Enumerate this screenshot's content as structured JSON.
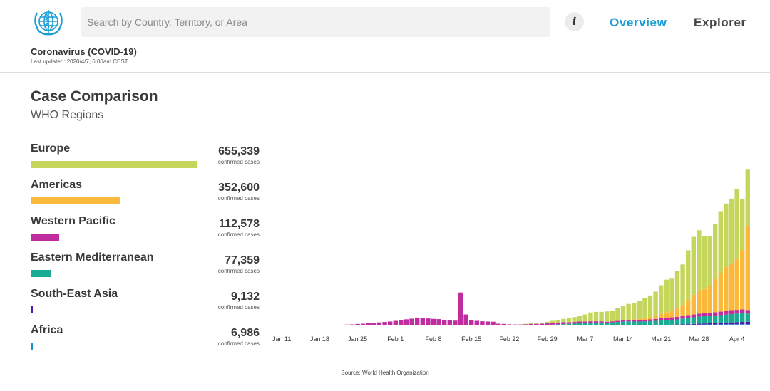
{
  "header": {
    "search_placeholder": "Search by Country, Territory, or Area",
    "info_label": "i",
    "nav": [
      "Overview",
      "Explorer"
    ],
    "app_title": "Coronavirus (COVID-19)",
    "last_updated": "Last updated: 2020/4/7, 6:00am CEST"
  },
  "section": {
    "title": "Case Comparison",
    "subtitle": "WHO Regions"
  },
  "regions": [
    {
      "name": "Europe",
      "value": "655,339",
      "label": "confirmed cases",
      "cases": 655339,
      "color": "#c4d65c"
    },
    {
      "name": "Americas",
      "value": "352,600",
      "label": "confirmed cases",
      "cases": 352600,
      "color": "#fbb93b"
    },
    {
      "name": "Western Pacific",
      "value": "112,578",
      "label": "confirmed cases",
      "cases": 112578,
      "color": "#bf2d9e"
    },
    {
      "name": "Eastern Mediterranean",
      "value": "77,359",
      "label": "confirmed cases",
      "cases": 77359,
      "color": "#19ab93"
    },
    {
      "name": "South-East Asia",
      "value": "9,132",
      "label": "confirmed cases",
      "cases": 9132,
      "color": "#4c1aa8"
    },
    {
      "name": "Africa",
      "value": "6,986",
      "label": "confirmed cases",
      "cases": 6986,
      "color": "#1c8fd1"
    }
  ],
  "chart_data": {
    "type": "bar",
    "stacked": true,
    "x_ticks": [
      "Jan 11",
      "Jan 18",
      "Jan 25",
      "Feb 1",
      "Feb 8",
      "Feb 15",
      "Feb 22",
      "Feb 29",
      "Mar 7",
      "Mar 14",
      "Mar 21",
      "Mar 28",
      "Apr 4"
    ],
    "x": [
      "Jan 11",
      "Jan 12",
      "Jan 13",
      "Jan 14",
      "Jan 15",
      "Jan 16",
      "Jan 17",
      "Jan 18",
      "Jan 19",
      "Jan 20",
      "Jan 21",
      "Jan 22",
      "Jan 23",
      "Jan 24",
      "Jan 25",
      "Jan 26",
      "Jan 27",
      "Jan 28",
      "Jan 29",
      "Jan 30",
      "Jan 31",
      "Feb 1",
      "Feb 2",
      "Feb 3",
      "Feb 4",
      "Feb 5",
      "Feb 6",
      "Feb 7",
      "Feb 8",
      "Feb 9",
      "Feb 10",
      "Feb 11",
      "Feb 12",
      "Feb 13",
      "Feb 14",
      "Feb 15",
      "Feb 16",
      "Feb 17",
      "Feb 18",
      "Feb 19",
      "Feb 20",
      "Feb 21",
      "Feb 22",
      "Feb 23",
      "Feb 24",
      "Feb 25",
      "Feb 26",
      "Feb 27",
      "Feb 28",
      "Feb 29",
      "Mar 1",
      "Mar 2",
      "Mar 3",
      "Mar 4",
      "Mar 5",
      "Mar 6",
      "Mar 7",
      "Mar 8",
      "Mar 9",
      "Mar 10",
      "Mar 11",
      "Mar 12",
      "Mar 13",
      "Mar 14",
      "Mar 15",
      "Mar 16",
      "Mar 17",
      "Mar 18",
      "Mar 19",
      "Mar 20",
      "Mar 21",
      "Mar 22",
      "Mar 23",
      "Mar 24",
      "Mar 25",
      "Mar 26",
      "Mar 27",
      "Mar 28",
      "Mar 29",
      "Mar 30",
      "Mar 31",
      "Apr 1",
      "Apr 2",
      "Apr 3",
      "Apr 4",
      "Apr 5",
      "Apr 6"
    ],
    "series": [
      {
        "name": "Africa",
        "color": "#1c8fd1",
        "values": [
          0,
          0,
          0,
          0,
          0,
          0,
          0,
          0,
          0,
          0,
          0,
          0,
          0,
          0,
          0,
          0,
          0,
          0,
          0,
          0,
          0,
          0,
          0,
          0,
          0,
          0,
          0,
          0,
          0,
          0,
          0,
          0,
          0,
          0,
          0,
          0,
          0,
          0,
          0,
          0,
          0,
          0,
          0,
          0,
          0,
          0,
          0,
          0,
          0,
          0,
          0,
          0,
          0,
          0,
          0,
          0,
          0,
          0,
          0,
          0,
          0,
          0,
          0,
          0,
          0,
          0,
          50,
          60,
          80,
          100,
          150,
          180,
          200,
          250,
          300,
          300,
          350,
          400,
          450,
          500,
          500,
          500,
          550,
          600,
          600,
          600,
          550
        ]
      },
      {
        "name": "South-East Asia",
        "color": "#4c1aa8",
        "values": [
          0,
          0,
          0,
          0,
          0,
          0,
          0,
          0,
          0,
          0,
          0,
          0,
          0,
          0,
          0,
          0,
          0,
          0,
          0,
          0,
          0,
          0,
          0,
          0,
          0,
          0,
          0,
          0,
          0,
          0,
          0,
          0,
          0,
          0,
          0,
          0,
          0,
          0,
          0,
          0,
          0,
          0,
          0,
          0,
          0,
          0,
          0,
          0,
          0,
          0,
          0,
          0,
          0,
          0,
          0,
          0,
          0,
          0,
          0,
          0,
          0,
          0,
          0,
          0,
          0,
          0,
          50,
          60,
          80,
          100,
          150,
          150,
          200,
          200,
          250,
          300,
          350,
          400,
          450,
          500,
          550,
          600,
          700,
          800,
          900,
          1000,
          1100
        ]
      },
      {
        "name": "Eastern Mediterranean",
        "color": "#19ab93",
        "values": [
          0,
          0,
          0,
          0,
          0,
          0,
          0,
          0,
          0,
          0,
          0,
          0,
          0,
          0,
          0,
          0,
          0,
          0,
          0,
          0,
          0,
          0,
          0,
          0,
          0,
          0,
          0,
          0,
          0,
          0,
          0,
          0,
          0,
          0,
          0,
          0,
          0,
          0,
          0,
          0,
          0,
          0,
          0,
          10,
          50,
          100,
          150,
          200,
          200,
          250,
          400,
          500,
          600,
          700,
          800,
          1000,
          1100,
          1200,
          1300,
          1400,
          1200,
          1400,
          1600,
          1800,
          1900,
          1800,
          1700,
          1700,
          1800,
          1900,
          2000,
          2100,
          2200,
          2300,
          2600,
          2800,
          3000,
          3200,
          3300,
          3400,
          3500,
          3600,
          3700,
          3800,
          3900,
          4000,
          3800
        ]
      },
      {
        "name": "Western Pacific",
        "color": "#bf2d9e",
        "values": [
          0,
          0,
          0,
          0,
          0,
          0,
          0,
          20,
          80,
          150,
          200,
          300,
          400,
          500,
          700,
          800,
          1000,
          1200,
          1400,
          1600,
          1800,
          2100,
          2500,
          2800,
          3100,
          3600,
          3400,
          3200,
          3000,
          2900,
          2600,
          2400,
          2200,
          15000,
          5000,
          2600,
          2100,
          1900,
          1800,
          1700,
          800,
          700,
          500,
          450,
          400,
          450,
          500,
          550,
          600,
          700,
          800,
          900,
          900,
          800,
          800,
          800,
          700,
          700,
          600,
          500,
          500,
          500,
          500,
          500,
          500,
          600,
          600,
          700,
          800,
          900,
          1000,
          1000,
          1100,
          1200,
          1200,
          1300,
          1300,
          1400,
          1400,
          1500,
          1500,
          1600,
          1700,
          1800,
          1700,
          1700,
          1600
        ]
      },
      {
        "name": "Americas",
        "color": "#fbb93b",
        "values": [
          0,
          0,
          0,
          0,
          0,
          0,
          0,
          0,
          0,
          0,
          0,
          0,
          0,
          0,
          0,
          0,
          0,
          0,
          0,
          0,
          0,
          0,
          0,
          0,
          0,
          0,
          0,
          0,
          0,
          0,
          0,
          0,
          0,
          0,
          0,
          0,
          0,
          0,
          0,
          0,
          0,
          0,
          0,
          0,
          0,
          0,
          0,
          0,
          0,
          0,
          0,
          0,
          0,
          0,
          0,
          0,
          0,
          0,
          0,
          0,
          0,
          0,
          100,
          200,
          300,
          400,
          500,
          700,
          1000,
          1500,
          2000,
          2500,
          3000,
          4000,
          5000,
          7000,
          9000,
          10500,
          11000,
          12000,
          15000,
          17500,
          20000,
          21000,
          23000,
          27000,
          38000
        ]
      },
      {
        "name": "Europe",
        "color": "#c4d65c",
        "values": [
          0,
          0,
          0,
          0,
          0,
          0,
          0,
          0,
          0,
          0,
          0,
          0,
          0,
          0,
          0,
          0,
          0,
          0,
          0,
          0,
          0,
          0,
          0,
          0,
          0,
          0,
          0,
          0,
          0,
          0,
          0,
          0,
          0,
          0,
          0,
          0,
          0,
          0,
          0,
          0,
          0,
          0,
          0,
          0,
          100,
          200,
          300,
          400,
          500,
          700,
          900,
          1200,
          1500,
          1800,
          2200,
          2600,
          3200,
          4000,
          4300,
          4300,
          4700,
          4700,
          5700,
          6400,
          7100,
          7500,
          8400,
          9100,
          9900,
          10900,
          13000,
          14900,
          14600,
          16700,
          18400,
          22500,
          26300,
          27400,
          24200,
          22800,
          25100,
          28200,
          28800,
          29700,
          32000,
          23100,
          26100
        ]
      }
    ],
    "ylim": [
      0,
      80000
    ],
    "source": "Source: World Health Organization"
  }
}
